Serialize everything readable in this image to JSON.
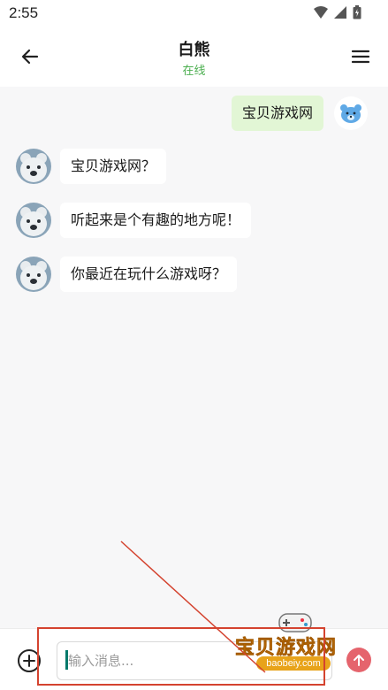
{
  "status_bar": {
    "time": "2:55"
  },
  "header": {
    "title": "白熊",
    "subtitle": "在线"
  },
  "messages": [
    {
      "sender": "user",
      "text": "宝贝游戏网"
    },
    {
      "sender": "bot",
      "text": "宝贝游戏网？"
    },
    {
      "sender": "bot",
      "text": "听起来是个有趣的地方呢！"
    },
    {
      "sender": "bot",
      "text": "你最近在玩什么游戏呀？"
    }
  ],
  "input": {
    "placeholder": "输入消息..."
  },
  "watermark": {
    "title": "宝贝游戏网",
    "url": "baobeiy.com"
  },
  "colors": {
    "online": "#4caf50",
    "user_bubble": "#e2f6d5",
    "send_button": "#e5646d",
    "annotation": "#d4432f"
  }
}
